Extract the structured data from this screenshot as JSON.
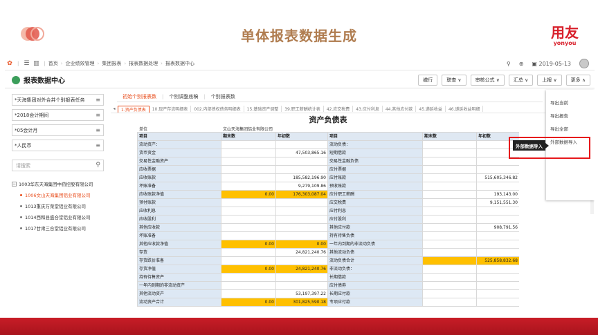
{
  "slide": {
    "title": "单体报表数据生成",
    "brand_cn": "用友",
    "brand_en": "yonyou"
  },
  "topnav": {
    "items": [
      "首页",
      "企业绩效管理",
      "集团报表",
      "报表数据处理",
      "报表数据中心"
    ],
    "date": "2019-05-13"
  },
  "header": {
    "title": "报表数据中心"
  },
  "toolbar": [
    "撤行",
    "联查 ∨",
    "审核公式 ∨",
    "汇总 ∨",
    "上报 ∨",
    "更多 ∧"
  ],
  "filters": [
    "*天海集团对外合并个别报表任务",
    "*2018会计期间",
    "*05会计月",
    "*人民币"
  ],
  "search": {
    "placeholder": "请搜索"
  },
  "tree": [
    {
      "label": "1003华东天海集团中药控股有限公司",
      "selected": false,
      "toggle": "−"
    },
    {
      "label": "1006文山天海集团铝业有限公司",
      "selected": true
    },
    {
      "label": "1013重庆万荣堂铝业有限公司",
      "selected": false
    },
    {
      "label": "1014西和县盛合堂铝业有限公司",
      "selected": false
    },
    {
      "label": "1017甘肃三合堂铝业有限公司",
      "selected": false
    }
  ],
  "report_tabs": [
    "初始个别报表数",
    "个别调整底稿",
    "个别报表数"
  ],
  "sheet_tabs": [
    "1.资产负债表",
    "10.现产存流明细表",
    "002.内部债权债务明细表",
    "15.基础资产调整",
    "39.职工薪酬统计表",
    "42.应交税费",
    "43.应付利息",
    "44.其他应付款",
    "45.递延收益",
    "46.递延收益明细"
  ],
  "sheet": {
    "title": "资产负债表",
    "unit_label": "单位",
    "company": "文山天海集团铝业有限公司",
    "headers": [
      "项目",
      "期末数",
      "年初数",
      "项目",
      "期末数",
      "年初数"
    ],
    "rows": [
      {
        "a": "流动资产：",
        "b": "",
        "c": "",
        "d": "流动负债：",
        "e": "",
        "f": "",
        "hl": []
      },
      {
        "a": "货币资金",
        "b": "",
        "c": "47,503,865.16",
        "d": "短期借款",
        "e": "",
        "f": "",
        "hl": []
      },
      {
        "a": "交易性金融资产",
        "b": "",
        "c": "",
        "d": "交易性金融负债",
        "e": "",
        "f": "",
        "hl": []
      },
      {
        "a": "应收票据",
        "b": "",
        "c": "",
        "d": "应付票据",
        "e": "",
        "f": "",
        "hl": []
      },
      {
        "a": "应收账款",
        "b": "",
        "c": "185,582,196.90",
        "d": "应付账款",
        "e": "",
        "f": "515,605,346.82",
        "hl": []
      },
      {
        "a": "坏账准备",
        "b": "",
        "c": "9,279,109.86",
        "d": "预收账款",
        "e": "",
        "f": "",
        "hl": []
      },
      {
        "a": "应收账款净值",
        "b": "0.00",
        "c": "176,303,087.04",
        "d": "应付职工薪酬",
        "e": "",
        "f": "193,143.00",
        "hl": [
          "b",
          "c"
        ]
      },
      {
        "a": "预付账款",
        "b": "",
        "c": "",
        "d": "应交税费",
        "e": "",
        "f": "9,151,551.30",
        "hl": []
      },
      {
        "a": "应收利息",
        "b": "",
        "c": "",
        "d": "应付利息",
        "e": "",
        "f": "",
        "hl": []
      },
      {
        "a": "应收股利",
        "b": "",
        "c": "",
        "d": "应付股利",
        "e": "",
        "f": "",
        "hl": []
      },
      {
        "a": "其他应收款",
        "b": "",
        "c": "",
        "d": "其他应付款",
        "e": "",
        "f": "908,791.56",
        "hl": []
      },
      {
        "a": "坏账准备",
        "b": "",
        "c": "",
        "d": "持有待售负债",
        "e": "",
        "f": "",
        "hl": []
      },
      {
        "a": "其他应收款净值",
        "b": "0.00",
        "c": "0.00",
        "d": "一年内到期的非流动负债",
        "e": "",
        "f": "",
        "hl": [
          "b",
          "c"
        ]
      },
      {
        "a": "存货",
        "b": "",
        "c": "24,821,240.76",
        "d": "其他流动负债",
        "e": "",
        "f": "",
        "hl": []
      },
      {
        "a": "存货跌价准备",
        "b": "",
        "c": "",
        "d": "流动负债合计",
        "e": "",
        "f": "525,858,832.68",
        "hl": [
          "e",
          "f"
        ]
      },
      {
        "a": "存货净值",
        "b": "0.00",
        "c": "24,821,240.76",
        "d": "非流动负债：",
        "e": "",
        "f": "",
        "hl": [
          "b",
          "c"
        ]
      },
      {
        "a": "持有待售资产",
        "b": "",
        "c": "",
        "d": "长期借款",
        "e": "",
        "f": "",
        "hl": []
      },
      {
        "a": "一年内到期的非流动资产",
        "b": "",
        "c": "",
        "d": "应付债券",
        "e": "",
        "f": "",
        "hl": []
      },
      {
        "a": "其他流动资产",
        "b": "",
        "c": "53,197,397.22",
        "d": "长期应付款",
        "e": "",
        "f": "",
        "hl": []
      },
      {
        "a": "流动资产合计",
        "b": "0.00",
        "c": "301,825,590.18",
        "d": "专项应付款",
        "e": "",
        "f": "",
        "hl": [
          "b",
          "c"
        ]
      }
    ]
  },
  "more_menu": [
    "导出当前",
    "导出报告",
    "导出全部",
    "外部数据导入"
  ],
  "tooltip": "外部数据导入"
}
